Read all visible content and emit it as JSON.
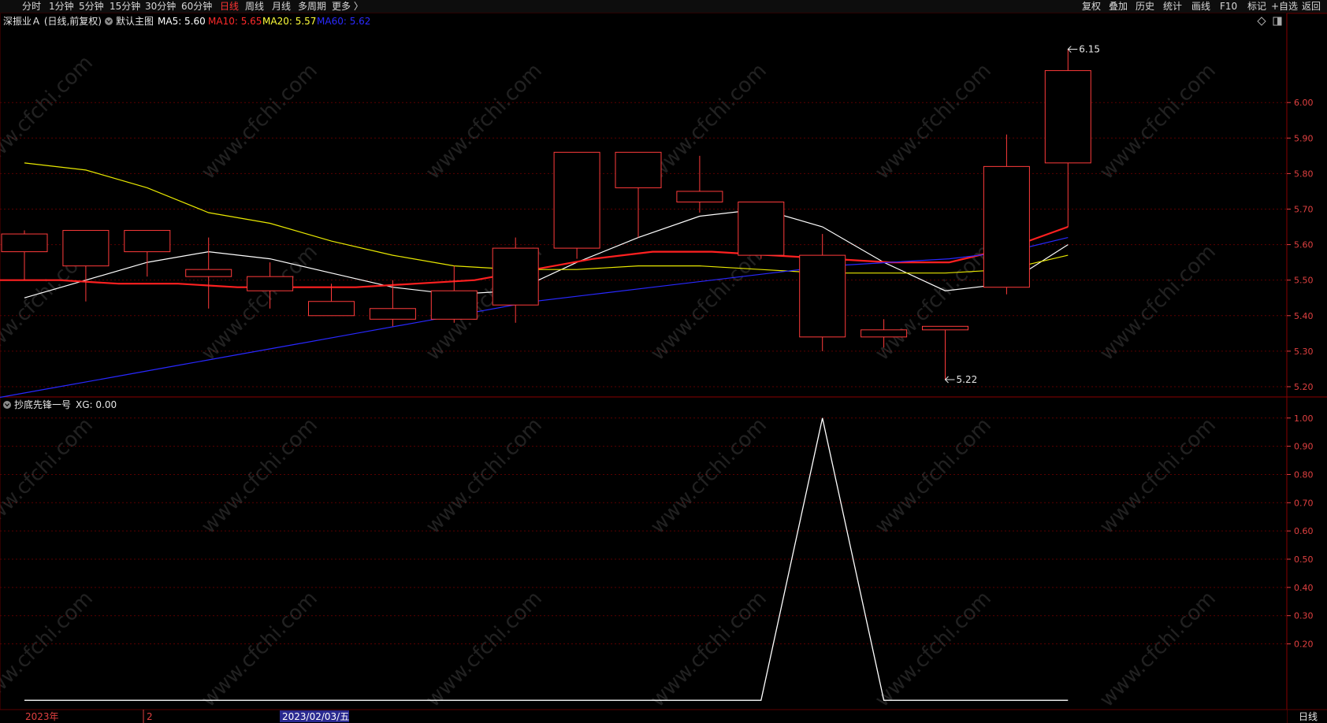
{
  "toolbar": {
    "periods": [
      "分时",
      "1分钟",
      "5分钟",
      "15分钟",
      "30分钟",
      "60分钟",
      "日线",
      "周线",
      "月线",
      "多周期",
      "更多 〉"
    ],
    "active_period": "日线",
    "right_buttons": [
      "复权",
      "叠加",
      "历史",
      "统计",
      "画线",
      "F10",
      "标记",
      "+自选",
      "返回"
    ]
  },
  "main_panel": {
    "stock_name": "深振业Ａ (日线,前复权)",
    "template": "默认主图",
    "ma_labels": [
      {
        "text": "MA5: 5.60",
        "color": "#ffffff"
      },
      {
        "text": "MA10: 5.65",
        "color": "#ff2a2a"
      },
      {
        "text": "MA20: 5.57",
        "color": "#ffff3a"
      },
      {
        "text": "MA60: 5.62",
        "color": "#2a2aff"
      }
    ],
    "high_marker": "6.15",
    "low_marker": "5.22"
  },
  "indicator_panel": {
    "title": "抄底先锋一号",
    "value_label": "XG: 0.00"
  },
  "bottom": {
    "date_labels": [
      "2023年",
      "2",
      "2023/02/03/五"
    ],
    "period_label": "日线"
  },
  "watermark": "www.cfchi.com",
  "colors": {
    "up": "#ff3b3b",
    "down": "#00ffff",
    "ma5": "#ffffff",
    "ma10": "#ff2020",
    "ma20": "#e8e800",
    "ma60": "#2828ff",
    "grid": "#5a0000",
    "axis_text": "#e04040"
  },
  "chart_data": [
    {
      "type": "candlestick",
      "title": "深振业Ａ (日线,前复权)",
      "y_ticks": [
        5.2,
        5.3,
        5.4,
        5.5,
        5.6,
        5.7,
        5.8,
        5.9,
        6.0
      ],
      "ylim": [
        5.18,
        6.2
      ],
      "grid": true,
      "candles": [
        {
          "o": 5.58,
          "h": 5.64,
          "l": 5.5,
          "c": 5.63
        },
        {
          "o": 5.54,
          "h": 5.64,
          "l": 5.44,
          "c": 5.64
        },
        {
          "o": 5.58,
          "h": 5.64,
          "l": 5.51,
          "c": 5.64
        },
        {
          "o": 5.51,
          "h": 5.62,
          "l": 5.42,
          "c": 5.53
        },
        {
          "o": 5.47,
          "h": 5.55,
          "l": 5.42,
          "c": 5.51
        },
        {
          "o": 5.4,
          "h": 5.49,
          "l": 5.4,
          "c": 5.44
        },
        {
          "o": 5.39,
          "h": 5.5,
          "l": 5.37,
          "c": 5.42
        },
        {
          "o": 5.39,
          "h": 5.54,
          "l": 5.38,
          "c": 5.47
        },
        {
          "o": 5.43,
          "h": 5.62,
          "l": 5.38,
          "c": 5.59
        },
        {
          "o": 5.59,
          "h": 5.86,
          "l": 5.56,
          "c": 5.86
        },
        {
          "o": 5.76,
          "h": 5.86,
          "l": 5.62,
          "c": 5.86
        },
        {
          "o": 5.72,
          "h": 5.85,
          "l": 5.69,
          "c": 5.75
        },
        {
          "o": 5.57,
          "h": 5.72,
          "l": 5.56,
          "c": 5.72
        },
        {
          "o": 5.34,
          "h": 5.63,
          "l": 5.3,
          "c": 5.57
        },
        {
          "o": 5.34,
          "h": 5.39,
          "l": 5.31,
          "c": 5.36
        },
        {
          "o": 5.36,
          "h": 5.37,
          "l": 5.22,
          "c": 5.37
        },
        {
          "o": 5.48,
          "h": 5.91,
          "l": 5.46,
          "c": 5.82
        },
        {
          "o": 5.83,
          "h": 6.15,
          "l": 5.65,
          "c": 6.09
        }
      ],
      "series": [
        {
          "name": "MA5",
          "values": [
            5.45,
            5.5,
            5.55,
            5.58,
            5.56,
            5.52,
            5.48,
            5.46,
            5.47,
            5.55,
            5.62,
            5.68,
            5.7,
            5.65,
            5.55,
            5.47,
            5.49,
            5.6
          ]
        },
        {
          "name": "MA10",
          "values": [
            5.5,
            5.5,
            5.49,
            5.49,
            5.48,
            5.48,
            5.48,
            5.49,
            5.5,
            5.53,
            5.56,
            5.58,
            5.58,
            5.57,
            5.56,
            5.55,
            5.55,
            5.59,
            5.65
          ]
        },
        {
          "name": "MA20",
          "values": [
            5.83,
            5.81,
            5.76,
            5.69,
            5.66,
            5.61,
            5.57,
            5.54,
            5.53,
            5.53,
            5.54,
            5.54,
            5.53,
            5.52,
            5.52,
            5.52,
            5.53,
            5.57
          ]
        },
        {
          "name": "MA60",
          "values": [
            5.17,
            5.2,
            5.23,
            5.26,
            5.29,
            5.32,
            5.35,
            5.38,
            5.41,
            5.44,
            5.46,
            5.48,
            5.5,
            5.52,
            5.54,
            5.55,
            5.56,
            5.58,
            5.62
          ]
        }
      ]
    },
    {
      "type": "line",
      "title": "抄底先锋一号",
      "y_ticks": [
        0.2,
        0.3,
        0.4,
        0.5,
        0.6,
        0.7,
        0.8,
        0.9,
        1.0
      ],
      "ylim": [
        -0.03,
        1.03
      ],
      "grid": true,
      "series": [
        {
          "name": "XG",
          "values": [
            0,
            0,
            0,
            0,
            0,
            0,
            0,
            0,
            0,
            0,
            0,
            0,
            0,
            1,
            0,
            0,
            0,
            0
          ]
        }
      ]
    }
  ]
}
